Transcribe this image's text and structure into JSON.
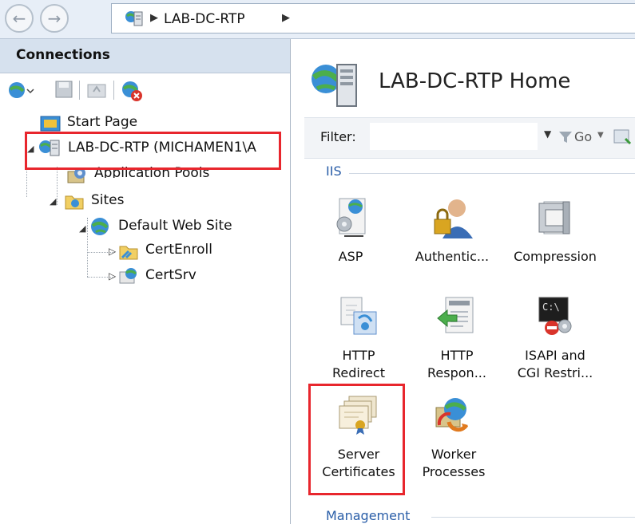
{
  "address_bar": {
    "breadcrumb": "LAB-DC-RTP",
    "back_icon": "back-arrow-icon",
    "forward_icon": "forward-arrow-icon"
  },
  "connections": {
    "title": "Connections",
    "tree": {
      "start_page": "Start Page",
      "server": "LAB-DC-RTP (MICHAMEN1\\A",
      "application_pools": "Application Pools",
      "sites": "Sites",
      "default_web_site": "Default Web Site",
      "cert_enroll": "CertEnroll",
      "cert_srv": "CertSrv"
    }
  },
  "home": {
    "title": "LAB-DC-RTP Home",
    "filter_label": "Filter:",
    "filter_value": "",
    "go_label": "Go",
    "groups": {
      "iis": "IIS",
      "management": "Management"
    },
    "features": [
      {
        "label": [
          "ASP"
        ]
      },
      {
        "label": [
          "Authentic..."
        ]
      },
      {
        "label": [
          "Compression"
        ]
      },
      {
        "label": [
          "HTTP",
          "Redirect"
        ]
      },
      {
        "label": [
          "HTTP",
          "Respon..."
        ]
      },
      {
        "label": [
          "ISAPI and",
          "CGI Restri..."
        ]
      },
      {
        "label": [
          "Server",
          "Certificates"
        ]
      },
      {
        "label": [
          "Worker",
          "Processes"
        ]
      }
    ]
  },
  "colors": {
    "highlight": "#e8262d",
    "group_label": "#2a5ea8"
  }
}
